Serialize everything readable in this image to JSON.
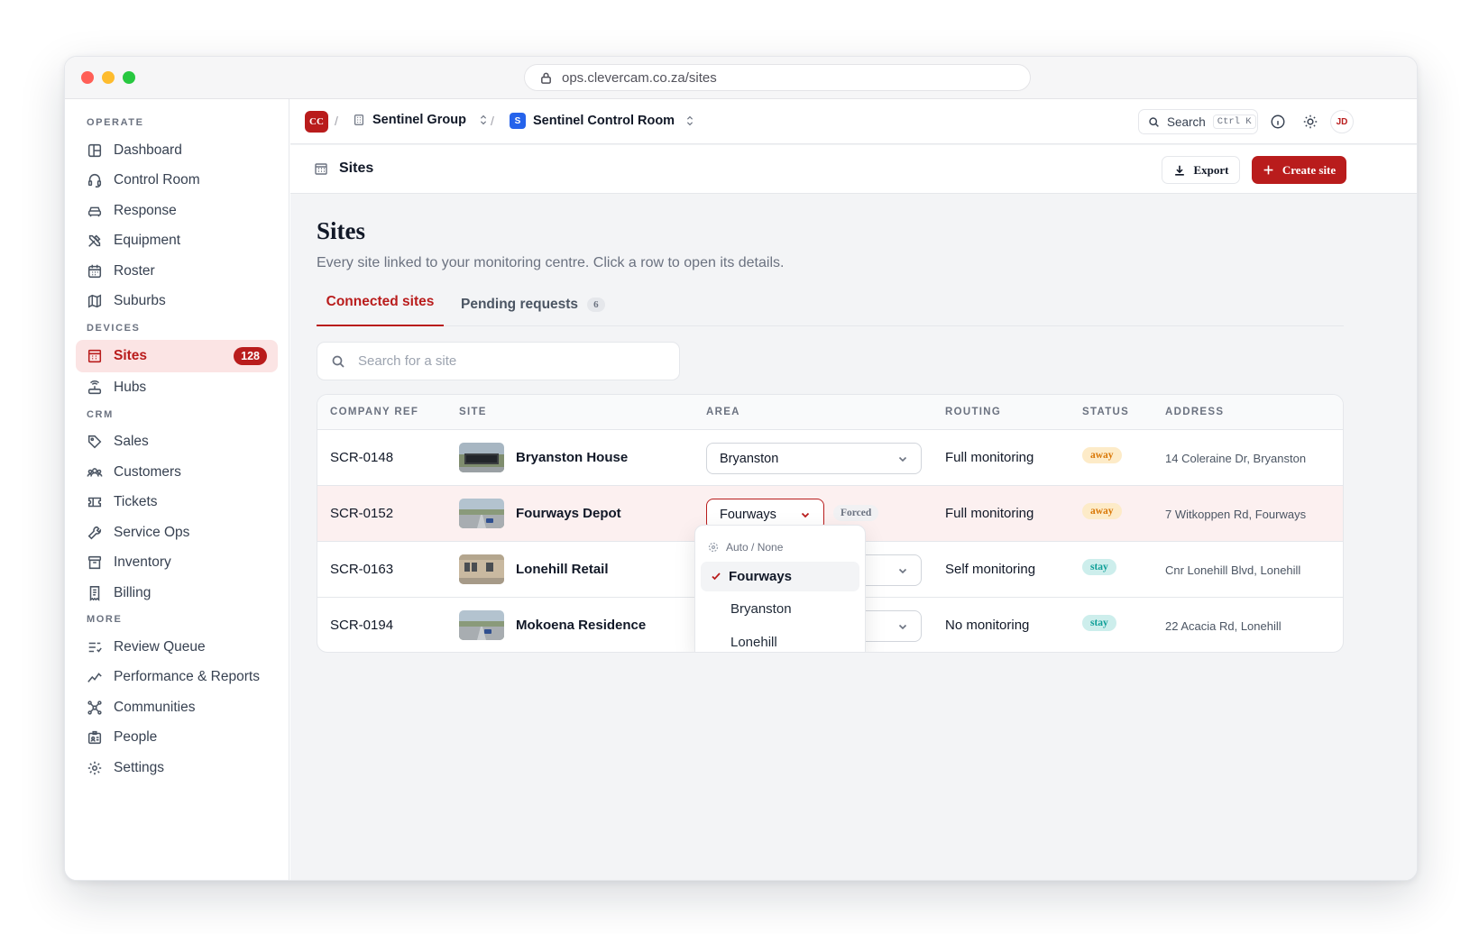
{
  "browser": {
    "url": "ops.clevercam.co.za/sites"
  },
  "sidebar": {
    "sections": [
      "OPERATE",
      "DEVICES",
      "CRM",
      "MORE"
    ],
    "items": [
      {
        "label": "Dashboard",
        "icon": "layout-icon"
      },
      {
        "label": "Control Room",
        "icon": "headset-icon"
      },
      {
        "label": "Response",
        "icon": "car-icon"
      },
      {
        "label": "Equipment",
        "icon": "tools-icon"
      },
      {
        "label": "Roster",
        "icon": "calendar-icon"
      },
      {
        "label": "Suburbs",
        "icon": "map-icon"
      },
      {
        "label": "Sites",
        "icon": "building-icon",
        "badge": "128",
        "active": true
      },
      {
        "label": "Hubs",
        "icon": "router-icon"
      },
      {
        "label": "Sales",
        "icon": "tag-icon"
      },
      {
        "label": "Customers",
        "icon": "users-icon"
      },
      {
        "label": "Tickets",
        "icon": "ticket-icon"
      },
      {
        "label": "Service Ops",
        "icon": "wrench-icon"
      },
      {
        "label": "Inventory",
        "icon": "archive-icon"
      },
      {
        "label": "Billing",
        "icon": "receipt-icon"
      },
      {
        "label": "Review Queue",
        "icon": "list-check-icon"
      },
      {
        "label": "Performance & Reports",
        "icon": "trend-icon"
      },
      {
        "label": "Communities",
        "icon": "network-icon"
      },
      {
        "label": "People",
        "icon": "id-card-icon"
      },
      {
        "label": "Settings",
        "icon": "gear-icon"
      }
    ]
  },
  "topbar": {
    "org_logo": "CC",
    "group": "Sentinel Group",
    "room_badge": "S",
    "room": "Sentinel Control Room",
    "search_label": "Search",
    "search_kbd": "Ctrl K",
    "avatar": "JD"
  },
  "pagebar": {
    "title": "Sites",
    "export_label": "Export",
    "create_label": "Create site"
  },
  "page": {
    "heading": "Sites",
    "subtitle": "Every site linked to your monitoring centre. Click a row to open its details.",
    "tabs": [
      {
        "label": "Connected sites"
      },
      {
        "label": "Pending requests",
        "count": "6"
      }
    ],
    "search_placeholder": "Search for a site"
  },
  "table": {
    "headers": [
      "COMPANY REF",
      "SITE",
      "AREA",
      "ROUTING",
      "STATUS",
      "ADDRESS"
    ],
    "rows": [
      {
        "ref": "SCR-0148",
        "site": "Bryanston House",
        "area": "Bryanston",
        "routing": "Full monitoring",
        "status": "away",
        "address": "14 Coleraine Dr, Bryanston"
      },
      {
        "ref": "SCR-0152",
        "site": "Fourways Depot",
        "area": "Fourways",
        "forced": "Forced",
        "routing": "Full monitoring",
        "status": "away",
        "address": "7 Witkoppen Rd, Fourways"
      },
      {
        "ref": "SCR-0163",
        "site": "Lonehill Retail",
        "area": "",
        "routing": "Self monitoring",
        "status": "stay",
        "address": "Cnr Lonehill Blvd, Lonehill"
      },
      {
        "ref": "SCR-0194",
        "site": "Mokoena Residence",
        "area": "",
        "routing": "No monitoring",
        "status": "stay",
        "address": "22 Acacia Rd, Lonehill"
      }
    ]
  },
  "area_dropdown": {
    "auto_label": "Auto / None",
    "options": [
      "Fourways",
      "Bryanston",
      "Lonehill"
    ],
    "selected": "Fourways"
  },
  "colors": {
    "accent": "#b91c1c",
    "away": "#d97706",
    "stay": "#0f9f98"
  }
}
